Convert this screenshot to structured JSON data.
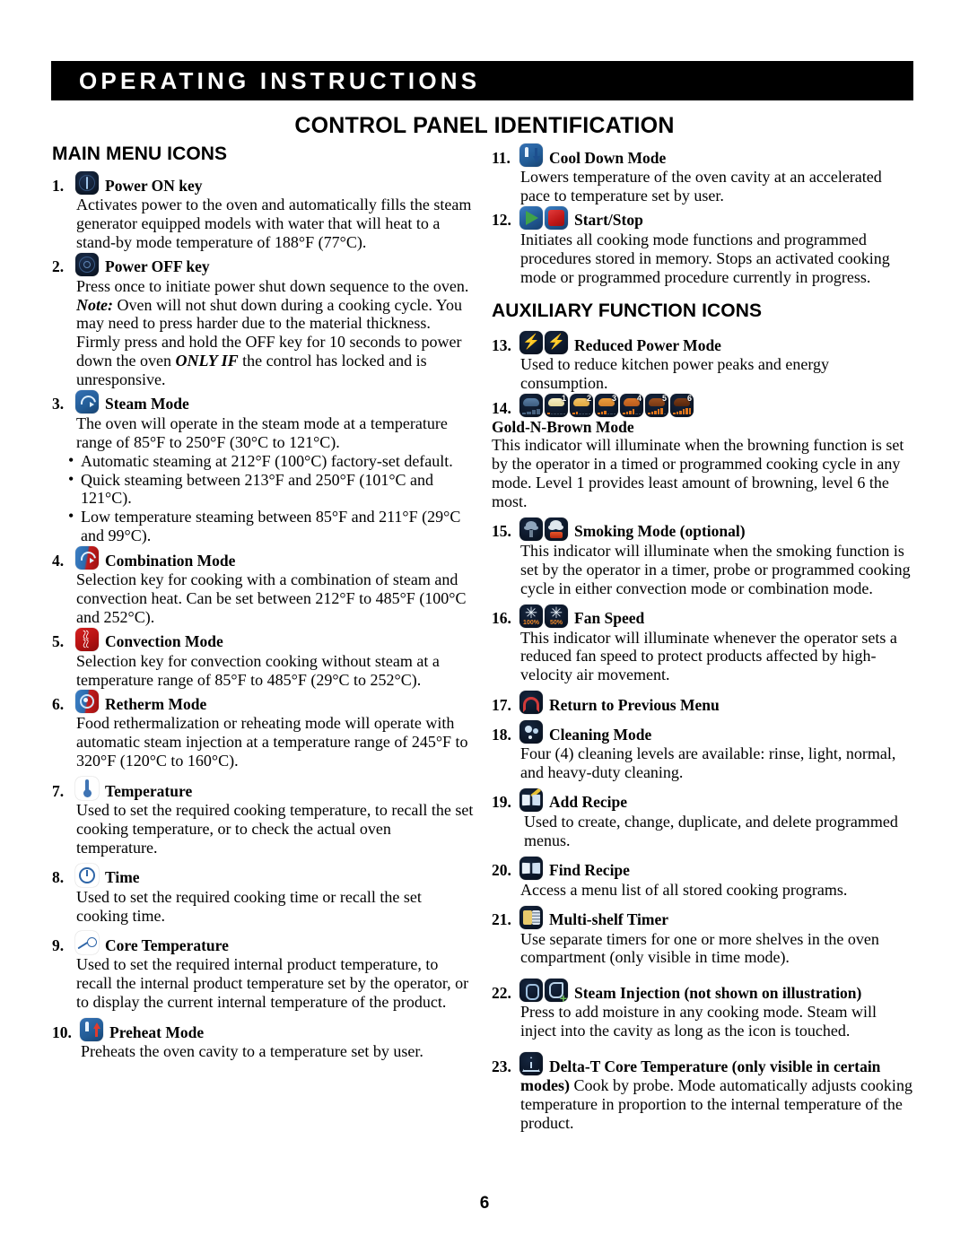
{
  "header": {
    "band_title": "OPERATING INSTRUCTIONS",
    "page_title": "CONTROL PANEL IDENTIFICATION"
  },
  "sections": {
    "main_menu_heading": "MAIN MENU ICONS",
    "auxiliary_heading": "AUXILIARY FUNCTION ICONS"
  },
  "page_number": "6",
  "items": {
    "i1": {
      "num": "1.",
      "label": "Power ON key",
      "body": "Activates power to the oven and automatically fills the steam generator equipped models with water that will heat to a stand-by mode temperature of 188°F (77°C)."
    },
    "i2": {
      "num": "2.",
      "label": "Power OFF key",
      "body_1": "Press once to initiate power shut down sequence to the oven. ",
      "body_note": "Note:",
      "body_2": " Oven will not shut down during a cooking cycle. You may need to press harder due to the material thickness. Firmly press and hold the OFF key for 10 seconds to power down the oven ",
      "body_onlyif": "ONLY IF",
      "body_3": " the control has locked and is unresponsive."
    },
    "i3": {
      "num": "3.",
      "label": "Steam Mode",
      "body": "The oven will operate in the steam mode at a temperature range of 85°F to 250°F (30°C to 121°C).",
      "bullets": [
        "Automatic steaming at 212°F (100°C) factory-set default.",
        "Quick steaming between 213°F and 250°F (101°C and 121°C).",
        "Low temperature steaming between 85°F and 211°F (29°C and 99°C)."
      ]
    },
    "i4": {
      "num": "4.",
      "label": "Combination Mode",
      "body": "Selection key for cooking with a combination of steam and convection heat. Can be set between 212°F to 485°F (100°C and 252°C)."
    },
    "i5": {
      "num": "5.",
      "label": "Convection Mode",
      "body": "Selection key for convection cooking without steam at a temperature range of 85°F to 485°F (29°C to 252°C)."
    },
    "i6": {
      "num": "6.",
      "label": "Retherm Mode",
      "body": "Food rethermalization or reheating mode will operate with automatic steam injection at a temperature range of 245°F to 320°F (120°C to 160°C)."
    },
    "i7": {
      "num": "7.",
      "label": "Temperature",
      "body": "Used to set the required cooking temperature, to recall the set cooking temperature, or to check the actual oven temperature."
    },
    "i8": {
      "num": "8.",
      "label": "Time",
      "body": "Used to set the required cooking time or recall the set cooking time."
    },
    "i9": {
      "num": "9.",
      "label": "Core Temperature",
      "body": "Used to set the required internal product temperature, to recall the internal product temperature set by the operator, or to display the current internal temperature of the product."
    },
    "i10": {
      "num": "10.",
      "label": "Preheat Mode",
      "body": "Preheats the oven cavity to a temperature set by user."
    },
    "i11": {
      "num": "11.",
      "label": "Cool Down Mode",
      "body": "Lowers temperature of the oven cavity at an accelerated pace to temperature set by user."
    },
    "i12": {
      "num": "12.",
      "label": "Start/Stop",
      "body": "Initiates all cooking mode functions and programmed procedures stored in memory. Stops an activated cooking mode or programmed procedure currently in progress."
    },
    "i13": {
      "num": "13.",
      "label": "Reduced Power Mode",
      "body": "Used to reduce kitchen power peaks and energy consumption."
    },
    "i14": {
      "num": "14.",
      "label": "Gold-N-Brown Mode",
      "body": "This indicator will illuminate when the browning function is set by the operator in a timed or programmed cooking cycle in any mode. Level 1 provides least amount of browning, level 6 the most.",
      "levels": [
        "1",
        "2",
        "3",
        "4",
        "5",
        "6"
      ]
    },
    "i15": {
      "num": "15.",
      "label": "Smoking Mode (optional)",
      "body": "This indicator will illuminate when the smoking function is set by the operator in a timer, probe or programmed cooking cycle in either convection mode or combination mode."
    },
    "i16": {
      "num": "16.",
      "label": "Fan Speed",
      "body": "This indicator will illuminate whenever the operator sets a reduced fan speed to protect products affected by high-velocity air movement.",
      "fan_full": "100%",
      "fan_half": "50%"
    },
    "i17": {
      "num": "17.",
      "label": "Return to Previous Menu"
    },
    "i18": {
      "num": "18.",
      "label": "Cleaning Mode",
      "body": "Four (4) cleaning levels are available: rinse, light, normal, and heavy-duty cleaning."
    },
    "i19": {
      "num": "19.",
      "label": "Add Recipe",
      "body": "Used to create, change, duplicate, and delete programmed menus."
    },
    "i20": {
      "num": "20.",
      "label": "Find Recipe",
      "body": "Access a menu list of all stored cooking programs."
    },
    "i21": {
      "num": "21.",
      "label": "Multi-shelf Timer",
      "body": "Use separate timers for one or more shelves in the oven compartment (only visible in time mode)."
    },
    "i22": {
      "num": "22.",
      "label": "Steam Injection (not shown on illustration)",
      "body": "Press to add moisture in any cooking mode. Steam will inject into the cavity as long as the icon is touched."
    },
    "i23": {
      "num": "23.",
      "label": "Delta-T Core Temperature (only visible in certain",
      "label_cont": "modes)",
      "body": " Cook by probe. Mode automatically adjusts cooking temperature in proportion to the internal temperature of the product."
    }
  }
}
